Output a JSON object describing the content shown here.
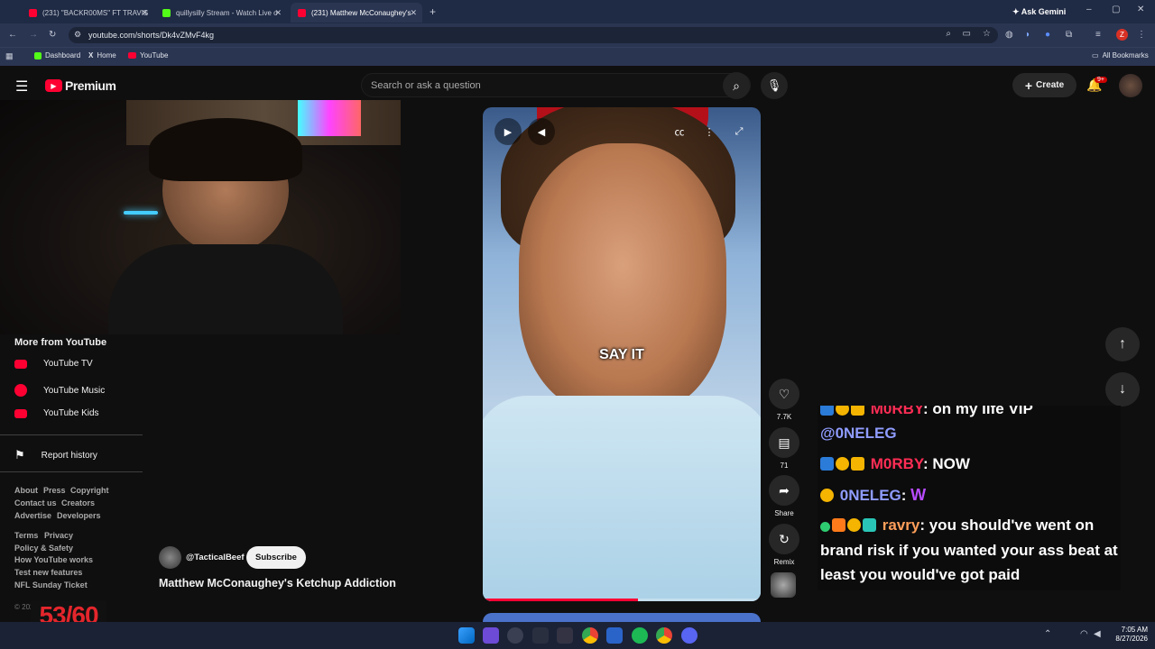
{
  "browser": {
    "tabs": [
      {
        "title": "(231) \"BACKR00MS\" FT TRAVIS",
        "color": "#ff0033"
      },
      {
        "title": "quillysilly Stream - Watch Live o",
        "color": "#53fc18"
      },
      {
        "title": "(231) Matthew McConaughey's",
        "color": "#ff0033"
      }
    ],
    "ask_gemini": "Ask Gemini",
    "url": "youtube.com/shorts/Dk4vZMvF4kg",
    "bookmarks": [
      "Dashboard",
      "Home",
      "YouTube"
    ],
    "all_bookmarks": "All Bookmarks",
    "profile_letter": "Z"
  },
  "youtube": {
    "logo": "Premium",
    "search_placeholder": "Search or ask a question",
    "create_label": "Create",
    "notif_count": "9+"
  },
  "sidebar": {
    "section_title": "More from YouTube",
    "items": [
      {
        "label": "YouTube TV",
        "icon": "youtube-tv-icon"
      },
      {
        "label": "YouTube Music",
        "icon": "youtube-music-icon"
      },
      {
        "label": "YouTube Kids",
        "icon": "youtube-kids-icon"
      }
    ],
    "report_history": "Report history",
    "footer_links_1": [
      "About",
      "Press",
      "Copyright",
      "Contact us",
      "Creators",
      "Advertise",
      "Developers"
    ],
    "footer_links_2": [
      "Terms",
      "Privacy",
      "Policy & Safety",
      "How YouTube works",
      "Test new features",
      "NFL Sunday Ticket"
    ],
    "copyright": "© 2026 Google LLC"
  },
  "counter_overlay": "53/60",
  "short": {
    "channel": "@TacticalBeef",
    "subscribe": "Subscribe",
    "title": "Matthew McConaughey's Ketchup Addiction",
    "caption": "SAY IT",
    "progress": 0.56,
    "likes": "7.7K",
    "comments": "71",
    "share": "Share",
    "remix": "Remix"
  },
  "chat": {
    "lines": [
      {
        "user": "M0RBY",
        "text": ": on my life VIP",
        "user_color": "#ff2d55"
      },
      {
        "user": "",
        "text": "@0NELEG",
        "user_color": "#8f9cff"
      },
      {
        "user": "M0RBY",
        "text": ": NOW",
        "user_color": "#ff2d55"
      },
      {
        "user": "0NELEG",
        "text": ":",
        "user_color": "#8f9cff"
      },
      {
        "user": "ravry",
        "text": ": you should've went on brand risk if you wanted your ass beat at least you would've got paid",
        "user_color": "#ff9f5a"
      }
    ]
  },
  "taskbar": {
    "time": "7:05 AM",
    "date": "8/27/2026"
  }
}
